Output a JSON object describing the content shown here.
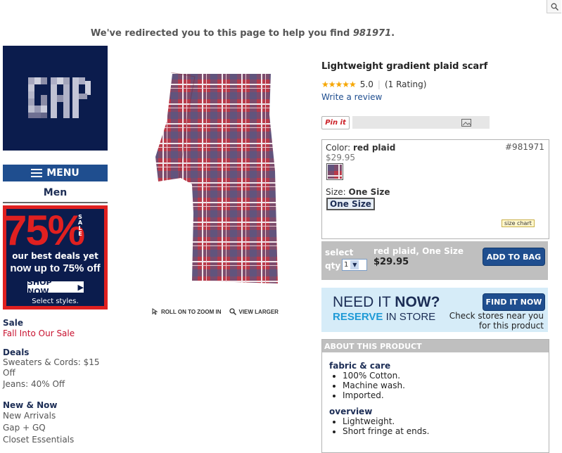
{
  "header": {
    "search_icon": "search-icon"
  },
  "redirect": {
    "prefix": "We've redirected you to this page to help you find ",
    "term": "981971",
    "suffix": "."
  },
  "logo": {
    "text": "GAP"
  },
  "menu": {
    "label": "MENU"
  },
  "category": "Men",
  "promo": {
    "big": "75%",
    "sale": "SALE",
    "line1": "our best deals yet",
    "line2": "now up to 75% off",
    "shop": "SHOP NOW",
    "select": "Select styles."
  },
  "nav": [
    {
      "heading": "Sale",
      "links": [
        {
          "label": "Fall Into Our Sale",
          "red": true
        }
      ]
    },
    {
      "heading": "Deals",
      "links": [
        {
          "label": "Sweaters & Cords: $15 Off"
        },
        {
          "label": "Jeans: 40% Off"
        }
      ]
    },
    {
      "heading": "New & Now",
      "links": [
        {
          "label": "New Arrivals"
        },
        {
          "label": "Gap + GQ"
        },
        {
          "label": "Closet Essentials"
        }
      ]
    }
  ],
  "image_tools": {
    "zoom": "ROLL ON TO ZOOM IN",
    "larger": "VIEW LARGER"
  },
  "product": {
    "title": "Lightweight gradient plaid scarf",
    "stars": "★★★★★",
    "rating": 1.0,
    "rating_value": "5.0",
    "rating_count": "(1 Rating)",
    "write_review": "Write a review",
    "pin": "Pin it",
    "color_label": "Color:",
    "color_value": "red plaid",
    "style_number": "#981971",
    "price": "$29.95",
    "size_label": "Size:",
    "size_value": "One Size",
    "size_option": "One Size",
    "size_chart": "size chart"
  },
  "bag": {
    "select": "select",
    "qty_label": "qty",
    "qty_value": "1",
    "summary": "red plaid, One Size",
    "price": "$29.95",
    "add": "ADD TO BAG"
  },
  "store": {
    "need": "NEED IT ",
    "now": "NOW?",
    "reserve": "RESERVE",
    "in_store": " IN STORE",
    "check": "Check stores near you for this product",
    "find": "FIND IT NOW"
  },
  "about": {
    "heading": "ABOUT THIS PRODUCT",
    "fabric_heading": "fabric & care",
    "fabric": [
      "100% Cotton.",
      "Machine wash.",
      "Imported."
    ],
    "overview_heading": "overview",
    "overview": [
      "Lightweight.",
      "Short fringe at ends."
    ]
  },
  "colors": {
    "navy": "#0b1c4d",
    "blue": "#1f4e8f",
    "red": "#e02020",
    "star": "#f6a600"
  }
}
